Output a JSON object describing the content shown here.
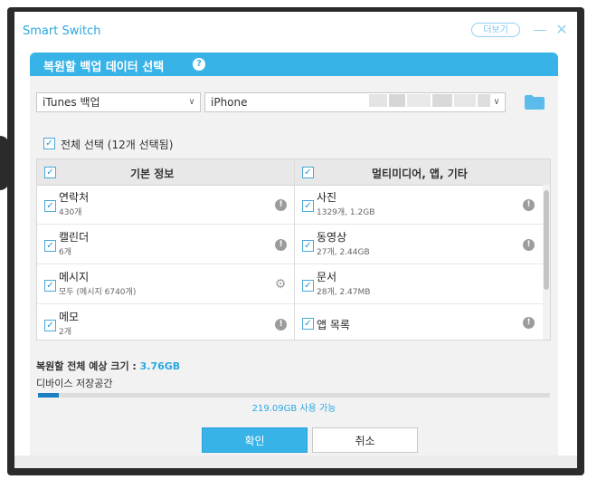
{
  "window": {
    "app_title": "Smart Switch",
    "more_label": "더보기"
  },
  "panel": {
    "title": "복원할 백업 데이터 선택"
  },
  "source": {
    "backup_select": "iTunes 백업",
    "device_select": "iPhone"
  },
  "select_all": {
    "label": "전체 선택 (12개 선택됨)"
  },
  "columns": {
    "basic": "기본 정보",
    "multimedia": "멀티미디어, 앱, 기타"
  },
  "basic_items": [
    {
      "name": "연락처",
      "sub": "430개",
      "icon": "info-icon"
    },
    {
      "name": "캘린더",
      "sub": "6개",
      "icon": "info-icon"
    },
    {
      "name": "메시지",
      "sub": "모두 (메시지 6740개)",
      "icon": "gear-icon"
    },
    {
      "name": "메모",
      "sub": "2개",
      "icon": "info-icon"
    }
  ],
  "media_items": [
    {
      "name": "사진",
      "sub": "1329개, 1.2GB",
      "icon": "info-icon"
    },
    {
      "name": "동영상",
      "sub": "27개, 2.44GB",
      "icon": "info-icon"
    },
    {
      "name": "문서",
      "sub": "28개, 2.47MB",
      "icon": "none"
    },
    {
      "name": "앱 목록",
      "sub": "",
      "icon": "info-icon"
    }
  ],
  "summary": {
    "size_label": "복원할 전체 예상 크기 : ",
    "size_value": "3.76GB",
    "storage_label": "디바이스 저장공간",
    "storage_used_fraction": 0.04,
    "storage_free": "219.09GB 사용 가능"
  },
  "buttons": {
    "ok": "확인",
    "cancel": "취소"
  },
  "colors": {
    "accent": "#38b3e8",
    "storage_fill": "#1b7fc4",
    "text_accent": "#2aa8e0"
  }
}
